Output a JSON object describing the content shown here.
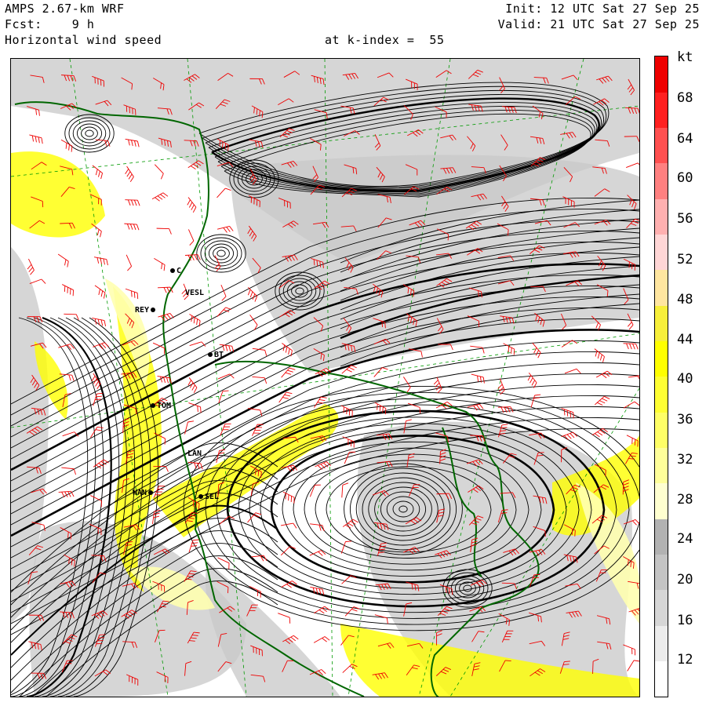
{
  "header": {
    "model": "AMPS 2.67-km WRF",
    "forecast": "Fcst:    9 h",
    "field": "Horizontal wind speed",
    "level": "at k-index =  55",
    "init": "Init: 12 UTC Sat 27 Sep 25",
    "valid": "Valid: 21 UTC Sat 27 Sep 25"
  },
  "colorbar": {
    "unit": "kt",
    "labels": [
      "68",
      "64",
      "60",
      "56",
      "52",
      "48",
      "44",
      "40",
      "36",
      "32",
      "28",
      "24",
      "20",
      "16",
      "12"
    ],
    "colors": [
      "#ffffff",
      "#ececec",
      "#d6d6d6",
      "#c4c4c4",
      "#b2b2b2",
      "#ffffd0",
      "#ffff9a",
      "#ffff66",
      "#ffff33",
      "#ffff00",
      "#f7ef3a",
      "#ffe6a0",
      "#ffd6d6",
      "#ffb0b0",
      "#ff8080",
      "#ff5050",
      "#ff2020",
      "#ee0000"
    ]
  },
  "stations": [
    {
      "code": "C"
    },
    {
      "code": "VESL"
    },
    {
      "code": "REY"
    },
    {
      "code": "BT"
    },
    {
      "code": "TOM"
    },
    {
      "code": "LAN"
    },
    {
      "code": "WAN"
    },
    {
      "code": "SEL"
    }
  ],
  "map": {
    "shading_colors": {
      "calm": "#ffffff",
      "grey": "#c8c8c8",
      "yellow": "#ffff00",
      "pale": "#ffffb0"
    },
    "coast_color": "#006600",
    "barb_color": "#ee0000",
    "streamline_color": "#000000",
    "grid_color": "#009900"
  }
}
